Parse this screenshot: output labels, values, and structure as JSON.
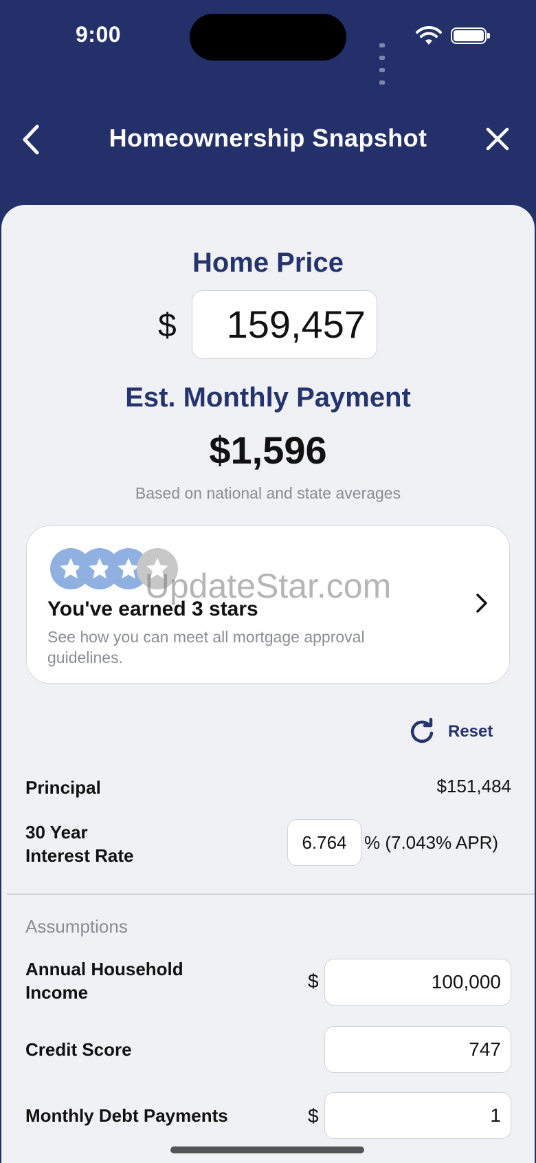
{
  "status_bar": {
    "time": "9:00"
  },
  "header": {
    "title": "Homeownership Snapshot"
  },
  "home_price": {
    "label": "Home Price",
    "currency": "$",
    "value": "159,457"
  },
  "payment": {
    "label": "Est. Monthly Payment",
    "value": "$1,596",
    "note": "Based on national and state averages"
  },
  "stars_card": {
    "earned": 3,
    "total": 4,
    "title": "You've earned 3 stars",
    "description": "See how you can meet all mortgage approval guidelines.",
    "watermark": "UpdateStar.com"
  },
  "reset": {
    "label": "Reset"
  },
  "principal": {
    "label": "Principal",
    "value": "$151,484"
  },
  "interest": {
    "label_line1": "30 Year",
    "label_line2": "Interest Rate",
    "rate": "6.764",
    "suffix": "% (7.043% APR)"
  },
  "assumptions": {
    "label": "Assumptions",
    "income": {
      "label_line1": "Annual Household",
      "label_line2": "Income",
      "currency": "$",
      "value": "100,000"
    },
    "credit": {
      "label": "Credit Score",
      "value": "747"
    },
    "debt": {
      "label": "Monthly Debt Payments",
      "currency": "$",
      "value": "1"
    }
  },
  "colors": {
    "brand": "#23306a",
    "accent_text": "#26346e",
    "star_on": "#8fb0e0",
    "star_off": "#c7c7c7"
  }
}
